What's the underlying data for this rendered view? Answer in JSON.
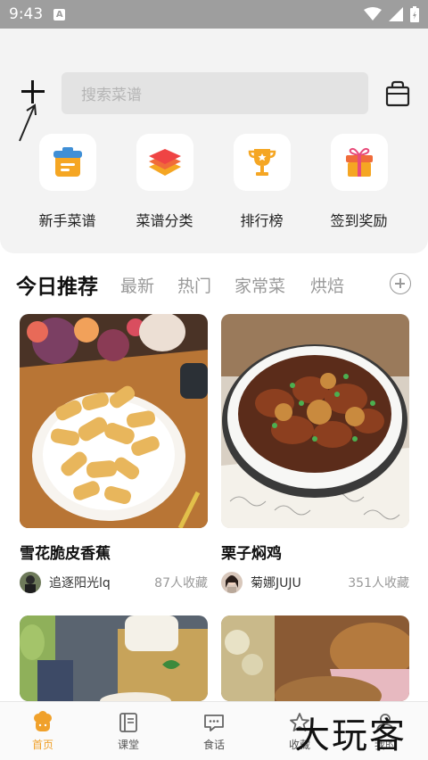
{
  "status_bar": {
    "time": "9:43",
    "notification_badge": "A"
  },
  "header": {
    "add_icon": "plus-icon",
    "search_placeholder": "搜索菜谱",
    "bag_icon": "shopping-bag-icon"
  },
  "quick_actions": [
    {
      "label": "新手菜谱",
      "icon": "clipboard-icon"
    },
    {
      "label": "菜谱分类",
      "icon": "layers-icon"
    },
    {
      "label": "排行榜",
      "icon": "trophy-icon"
    },
    {
      "label": "签到奖励",
      "icon": "gift-icon"
    }
  ],
  "tabs": [
    {
      "label": "今日推荐",
      "active": true
    },
    {
      "label": "最新",
      "active": false
    },
    {
      "label": "热门",
      "active": false
    },
    {
      "label": "家常菜",
      "active": false
    },
    {
      "label": "烘焙",
      "active": false
    }
  ],
  "recipes": [
    {
      "title": "雪花脆皮香蕉",
      "author": "追逐阳光lq",
      "saves": "87人收藏"
    },
    {
      "title": "栗子焖鸡",
      "author": "菊娜JUJU",
      "saves": "351人收藏"
    }
  ],
  "bottom_nav": [
    {
      "label": "首页",
      "icon": "home-chef-icon",
      "active": true
    },
    {
      "label": "课堂",
      "icon": "book-icon",
      "active": false
    },
    {
      "label": "食话",
      "icon": "chat-icon",
      "active": false
    },
    {
      "label": "收藏",
      "icon": "star-icon",
      "active": false
    },
    {
      "label": "我的",
      "icon": "user-icon",
      "active": false
    }
  ],
  "watermark": "大玩客",
  "colors": {
    "accent": "#f0a12b",
    "panel": "#f3f3f3",
    "status_bar": "#9e9e9e"
  }
}
